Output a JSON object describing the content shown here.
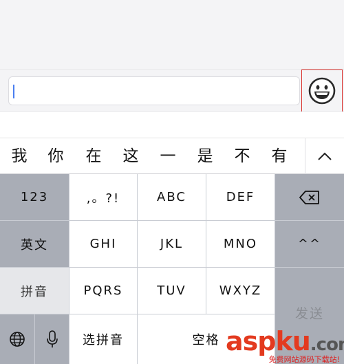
{
  "candidates": [
    "我",
    "你",
    "在",
    "这",
    "一",
    "是",
    "不",
    "有"
  ],
  "keys": {
    "numbers": "123",
    "punct": ",。?!",
    "abc": "ABC",
    "def": "DEF",
    "english": "英文",
    "ghi": "GHI",
    "jkl": "JKL",
    "mno": "MNO",
    "emoticon": "^^",
    "pinyin": "拼音",
    "pqrs": "PQRS",
    "tuv": "TUV",
    "wxyz": "WXYZ",
    "select_pinyin": "选拼音",
    "space": "空格",
    "send": "发送"
  },
  "watermark": {
    "brand_a": "aspku",
    "brand_b": ".com",
    "sub": "免费网站源码下载站!"
  },
  "colors": {
    "highlight_border": "#d9302c",
    "caret": "#4a7ef0",
    "watermark": "#e33a1f"
  }
}
